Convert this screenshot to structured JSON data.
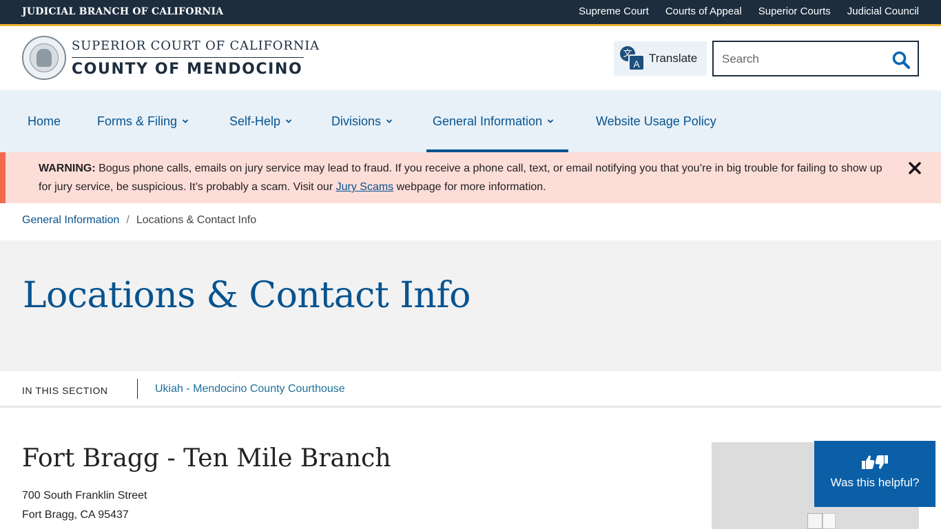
{
  "utility": {
    "branch_name": "JUDICIAL BRANCH OF CALIFORNIA",
    "links": [
      "Supreme Court",
      "Courts of Appeal",
      "Superior Courts",
      "Judicial Council"
    ]
  },
  "header": {
    "logo_line_1": "SUPERIOR COURT OF CALIFORNIA",
    "logo_line_2": "COUNTY OF MENDOCINO",
    "logo_icon": "court-seal-icon",
    "translate_label": "Translate",
    "translate_icon": "translate-icon",
    "search_placeholder": "Search",
    "search_icon": "search-icon"
  },
  "nav": {
    "items": [
      {
        "label": "Home"
      },
      {
        "label": "Forms & Filing"
      },
      {
        "label": "Self-Help"
      },
      {
        "label": "Divisions"
      },
      {
        "label": "General Information"
      },
      {
        "label": "Website Usage Policy"
      }
    ],
    "active": "General Information"
  },
  "alert": {
    "label": "WARNING:",
    "text_before_link": " Bogus phone calls, emails on jury service may lead to fraud.  If you receive a phone call, text, or email notifying you that you’re in big trouble for failing to show up for jury service, be suspicious.  It’s probably a scam.  Visit our ",
    "link_text": "Jury Scams",
    "text_after_link": " webpage for more information.",
    "close_icon": "close-icon"
  },
  "breadcrumb": {
    "parent": "General Information",
    "separator": "/",
    "current": "Locations & Contact Info"
  },
  "hero": {
    "title": "Locations & Contact Info"
  },
  "section_nav": {
    "label": "IN THIS SECTION",
    "link": "Ukiah - Mendocino County Courthouse"
  },
  "location": {
    "title": "Fort Bragg - Ten Mile Branch",
    "address_line_1": "700 South Franklin Street",
    "address_line_2": "Fort Bragg, CA 95437"
  },
  "feedback": {
    "label": "Was this helpful?",
    "icon": "thumbs-up-down-icon"
  },
  "colors": {
    "primary": "#07538f",
    "dark": "#1d2d3e",
    "gold": "#f2b230",
    "alert_bg": "#fdddd8",
    "alert_stripe": "#f26b4f",
    "feedback_bg": "#0a5fa7"
  }
}
